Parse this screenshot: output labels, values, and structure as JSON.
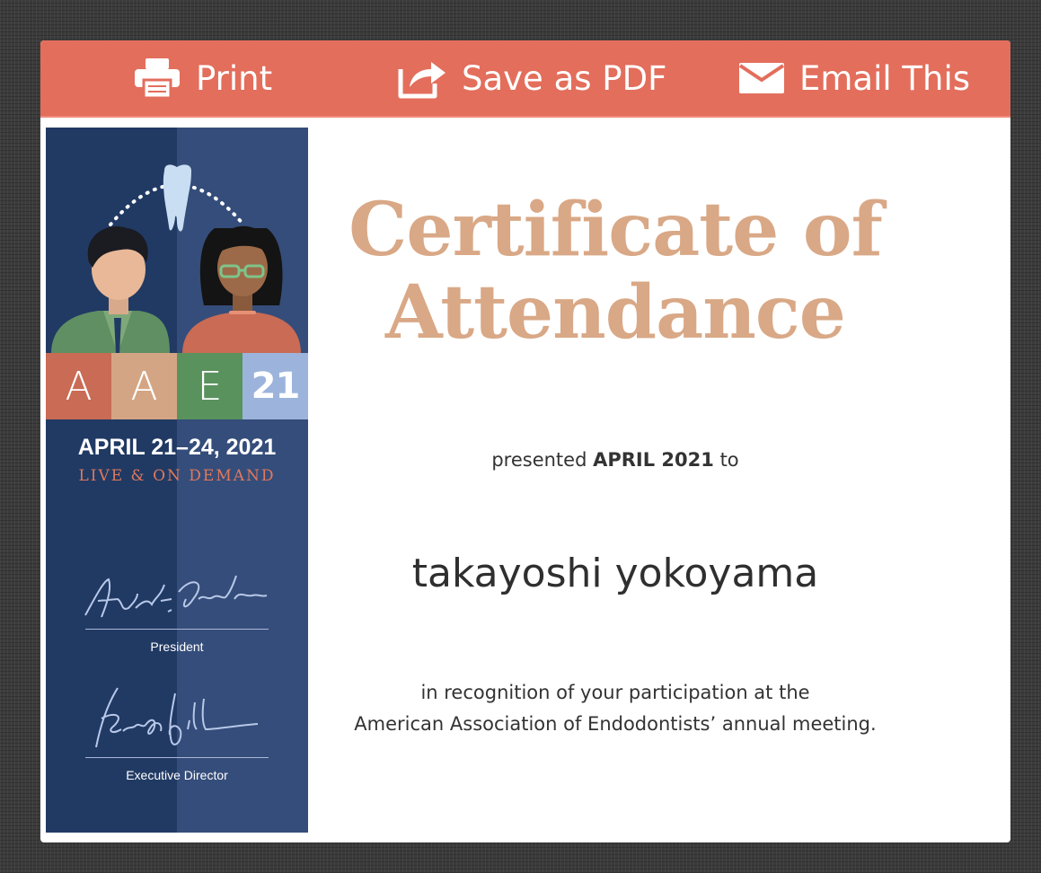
{
  "toolbar": {
    "print_label": "Print",
    "save_pdf_label": "Save as PDF",
    "email_label": "Email This",
    "icons": [
      "printer-icon",
      "share-icon",
      "envelope-icon"
    ],
    "background_color": "#e36e5c"
  },
  "sidebar": {
    "letters": [
      "A",
      "A",
      "E",
      "21"
    ],
    "letter_colors": [
      "#c96b55",
      "#d4a584",
      "#5a925e",
      "#9cb4dc"
    ],
    "dates": "APRIL 21–24, 2021",
    "subline": "LIVE & ON DEMAND",
    "signatures": [
      {
        "title": "President"
      },
      {
        "title": "Executive Director"
      }
    ]
  },
  "certificate": {
    "title_line1": "Certificate of",
    "title_line2": "Attendance",
    "presented_prefix": "presented",
    "presented_date": "APRIL 2021",
    "presented_suffix": "to",
    "recipient": "takayoshi yokoyama",
    "recognition_line1": "in recognition of your participation at the",
    "recognition_line2": "American Association of Endodontists’ annual meeting.",
    "title_color": "#d9a886"
  }
}
